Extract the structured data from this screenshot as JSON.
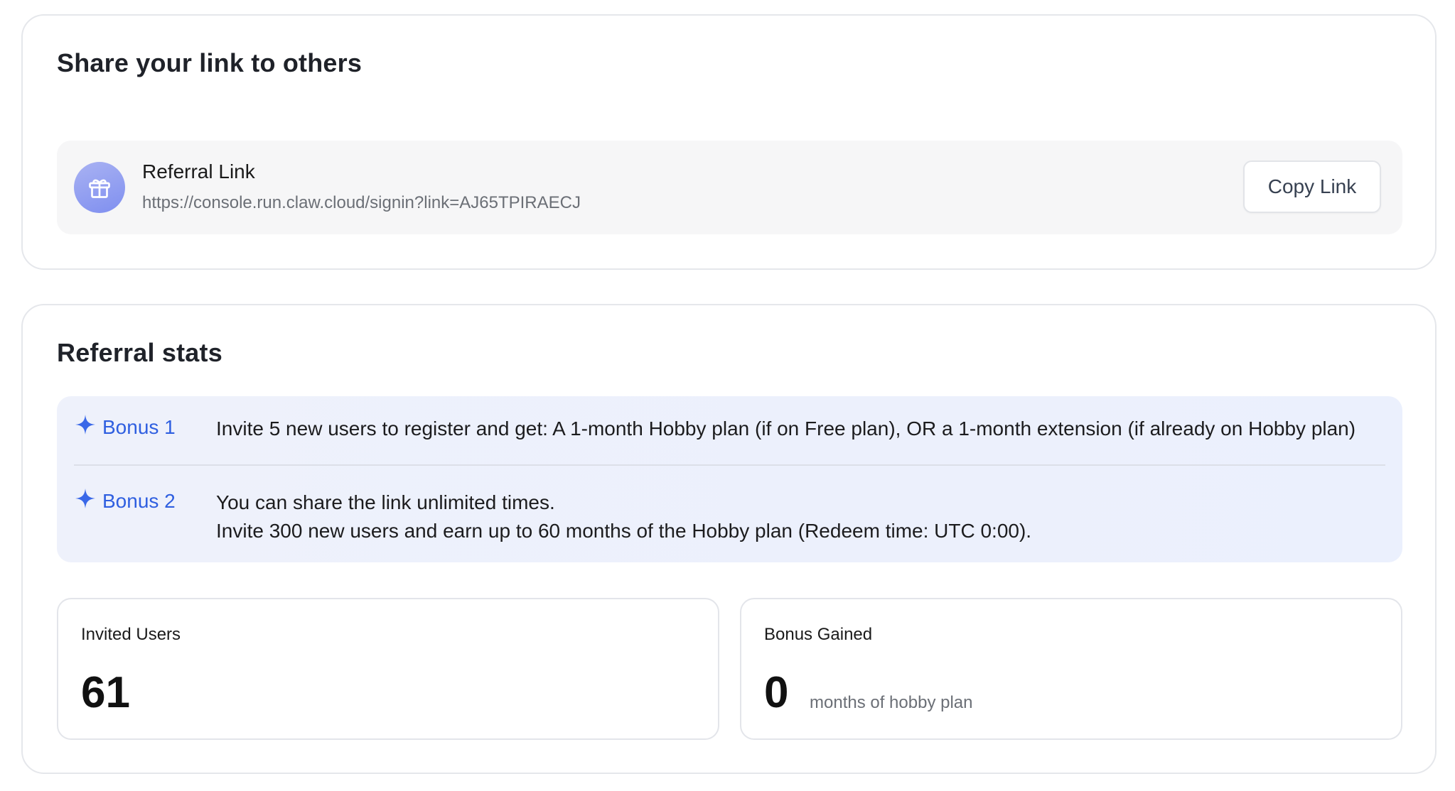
{
  "share": {
    "title": "Share your link to others",
    "link_label": "Referral Link",
    "link_url": "https://console.run.claw.cloud/signin?link=AJ65TPIRAECJ",
    "copy_button": "Copy Link",
    "icon": "gift-icon"
  },
  "stats": {
    "title": "Referral stats",
    "bonuses": [
      {
        "tag": "Bonus 1",
        "icon": "sparkle-icon",
        "lines": [
          "Invite 5 new users to register and get: A 1-month Hobby plan (if on Free plan), OR a 1-month extension (if already on Hobby plan)"
        ]
      },
      {
        "tag": "Bonus 2",
        "icon": "sparkle-icon",
        "lines": [
          "You can share the link unlimited times.",
          "Invite 300 new users and earn up to 60 months of the Hobby plan (Redeem time: UTC 0:00)."
        ]
      }
    ],
    "invited_users": {
      "label": "Invited Users",
      "value": "61"
    },
    "bonus_gained": {
      "label": "Bonus Gained",
      "value": "0",
      "unit": "months of hobby plan"
    }
  },
  "colors": {
    "accent": "#2f5fe0",
    "gift_badge": "#8e9cf2",
    "bonus_bg": "#edf1fc"
  }
}
